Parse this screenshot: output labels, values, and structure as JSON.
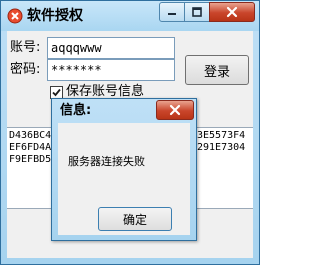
{
  "window": {
    "title": "软件授权"
  },
  "form": {
    "account_label": "账号:",
    "account_value": "aqqqwww",
    "password_label": "密码:",
    "password_value": "*******",
    "login_label": "登录",
    "remember_label": "保存账号信息",
    "remember_checked": true
  },
  "machine_code": {
    "left_lines": [
      "D436BC4",
      "EF6FD4A",
      "F9EFBD5"
    ],
    "right_lines": [
      "3E5573F4",
      "291E7304",
      ""
    ]
  },
  "dialog": {
    "title": "信息:",
    "message": "服务器连接失败",
    "ok_label": "确定"
  },
  "colors": {
    "title_gradient_top": "#c8e6f9",
    "title_gradient_bottom": "#a9d6f1",
    "close_red": "#c9452b",
    "client_bg": "#f0f0f0"
  }
}
